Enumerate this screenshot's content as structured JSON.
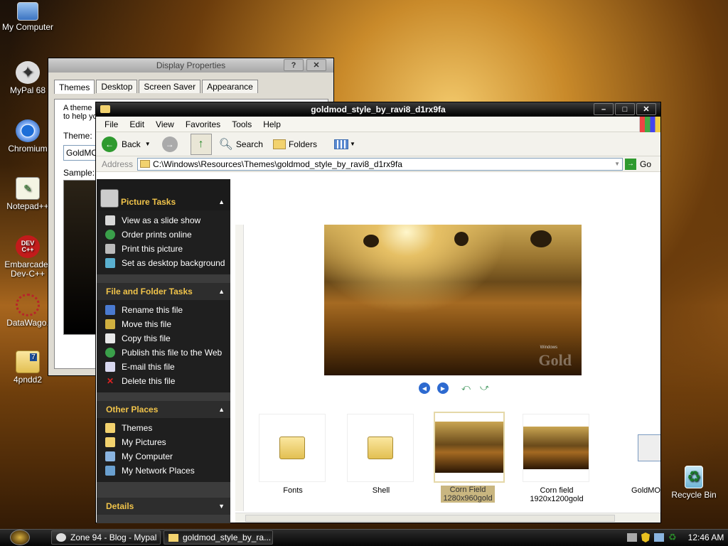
{
  "desktop": {
    "icons": [
      {
        "label": "My Computer",
        "icon": "computer-icon"
      },
      {
        "label": "MyPal 68",
        "icon": "mypal-icon"
      },
      {
        "label": "Chromium",
        "icon": "chromium-icon"
      },
      {
        "label": "Notepad++",
        "icon": "notepad-icon"
      },
      {
        "label": "Embarcadero Dev-C++",
        "line1": "Embarcader",
        "line2": "Dev-C++",
        "badge": "DEV C++",
        "icon": "devcpp-icon"
      },
      {
        "label": "DataWago.",
        "icon": "datawago-icon"
      },
      {
        "label": "4pndd2",
        "icon": "folder-icon"
      }
    ],
    "recycle_bin": {
      "label": "Recycle Bin",
      "icon": "recycle-bin-icon"
    }
  },
  "display_properties": {
    "title": "Display Properties",
    "title_buttons": [
      "?",
      "✕"
    ],
    "tabs": [
      "Themes",
      "Desktop",
      "Screen Saver",
      "Appearance"
    ],
    "active_tab": "Themes",
    "description": "A theme",
    "description2": "to help yo",
    "theme_label": "Theme:",
    "theme_value": "GoldMO",
    "sample_label": "Sample:"
  },
  "explorer": {
    "title": "goldmod_style_by_ravi8_d1rx9fa",
    "menu": [
      "File",
      "Edit",
      "View",
      "Favorites",
      "Tools",
      "Help"
    ],
    "toolbar": {
      "back": "Back",
      "search": "Search",
      "folders": "Folders"
    },
    "address_label": "Address",
    "address_value": "C:\\Windows\\Resources\\Themes\\goldmod_style_by_ravi8_d1rx9fa",
    "go_label": "Go",
    "sidebar": {
      "picture_tasks": {
        "title": "Picture Tasks",
        "items": [
          "View as a slide show",
          "Order prints online",
          "Print this picture",
          "Set as desktop background"
        ]
      },
      "file_tasks": {
        "title": "File and Folder Tasks",
        "items": [
          "Rename this file",
          "Move this file",
          "Copy this file",
          "Publish this file to the Web",
          "E-mail this file",
          "Delete this file"
        ]
      },
      "other_places": {
        "title": "Other Places",
        "items": [
          "Themes",
          "My Pictures",
          "My Computer",
          "My Network Places"
        ]
      },
      "details": {
        "title": "Details"
      }
    },
    "preview_watermark": "Gold",
    "preview_watermark_small": "Windows",
    "files": [
      {
        "name": "Fonts",
        "type": "folder"
      },
      {
        "name": "Shell",
        "type": "folder"
      },
      {
        "name": "Corn Field",
        "name2": "1280x960gold",
        "type": "image",
        "selected": true
      },
      {
        "name": "Corn field",
        "name2": "1920x1200gold",
        "type": "image"
      },
      {
        "name": "GoldMO",
        "type": "theme"
      }
    ]
  },
  "taskbar": {
    "tasks": [
      "Zone 94 - Blog - Mypal",
      "goldmod_style_by_ra..."
    ],
    "clock": "12:46 AM"
  },
  "colors": {
    "accent": "#f0c34a",
    "sidebar_bg": "#1f1f1f",
    "title_bg": "#000000"
  }
}
